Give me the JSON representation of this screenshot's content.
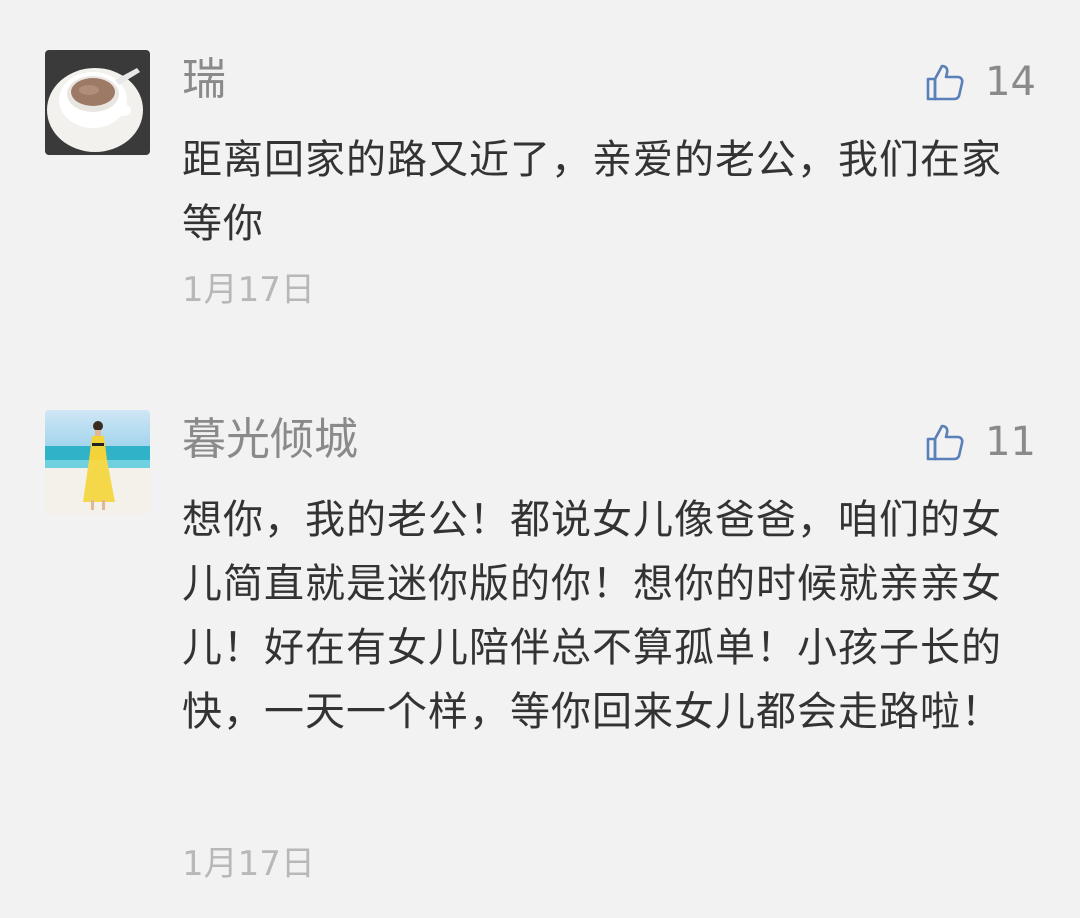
{
  "comments": [
    {
      "nickname": "瑞",
      "avatar_icon": "coffee-cup-avatar",
      "like_icon": "thumbs-up-icon",
      "like_count": "14",
      "content": "距离回家的路又近了，亲爱的老公，我们在家等你",
      "date": "1月17日"
    },
    {
      "nickname": "暮光倾城",
      "avatar_icon": "beach-woman-avatar",
      "like_icon": "thumbs-up-icon",
      "like_count": "11",
      "content": "想你，我的老公！都说女儿像爸爸，咱们的女儿简直就是迷你版的你！想你的时候就亲亲女儿！好在有女儿陪伴总不算孤单！小孩子长的快，一天一个样，等你回来女儿都会走路啦！",
      "date": "1月17日"
    }
  ],
  "colors": {
    "background": "#f2f2f2",
    "nickname": "#8a8a8a",
    "content": "#333333",
    "date": "#b8b8b8",
    "like_icon": "#5b7fb8"
  }
}
